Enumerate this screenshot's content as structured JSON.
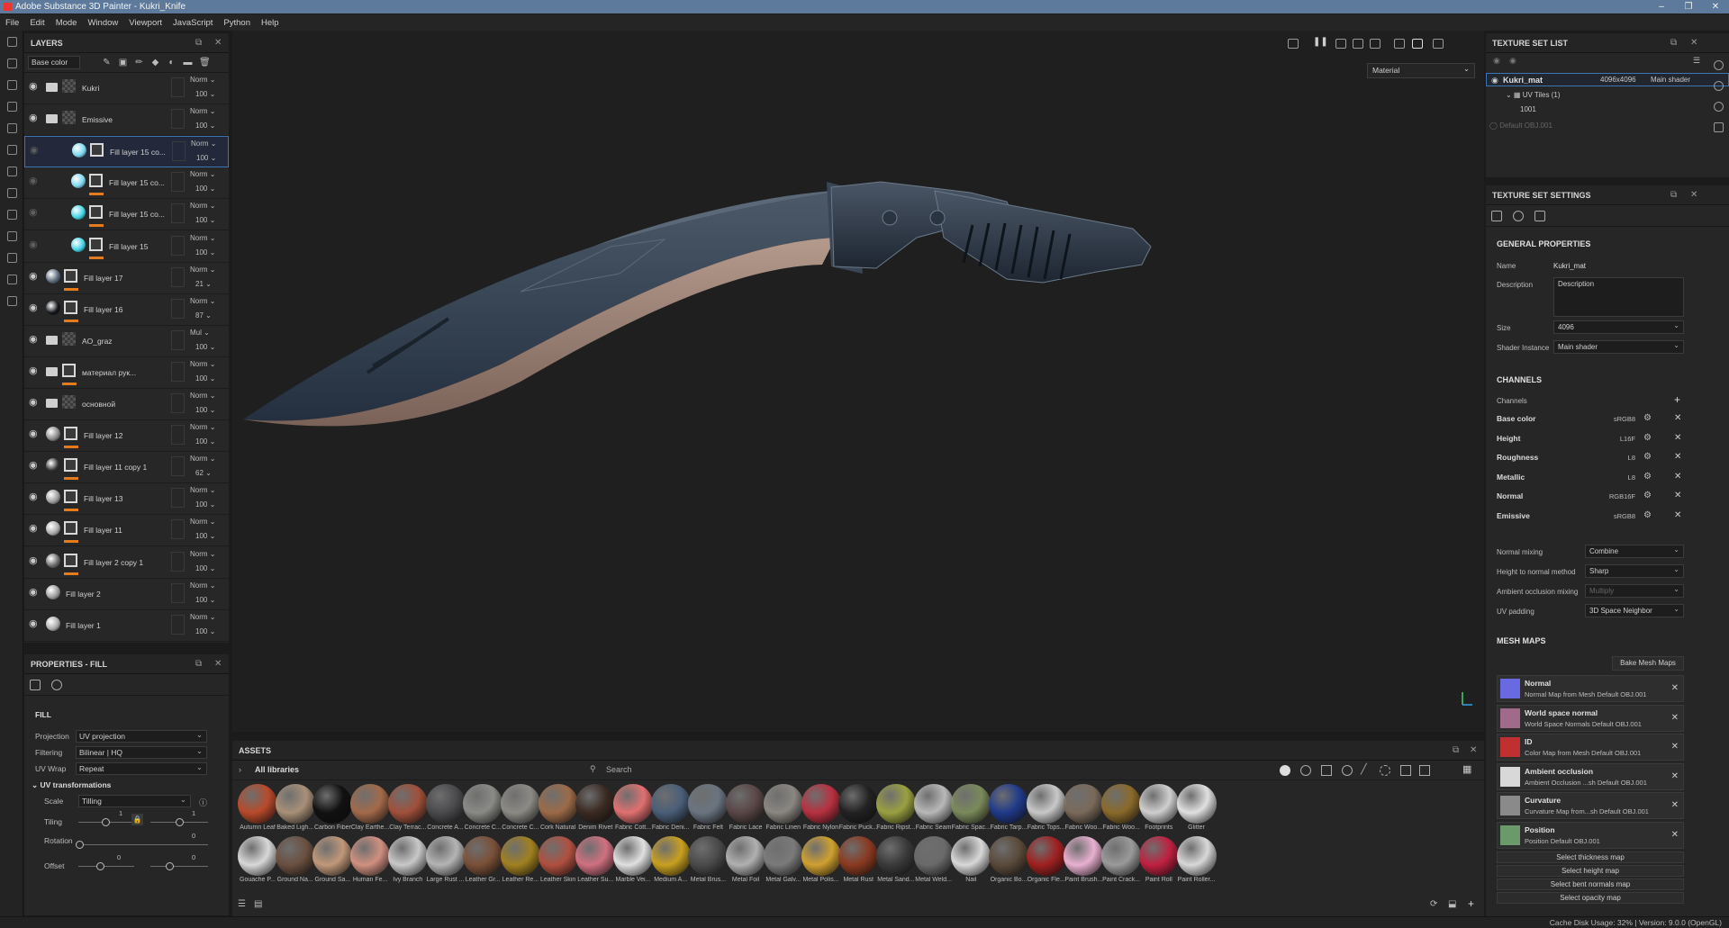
{
  "window": {
    "title": "Adobe Substance 3D Painter - Kukri_Knife"
  },
  "menu": [
    "File",
    "Edit",
    "Mode",
    "Window",
    "Viewport",
    "JavaScript",
    "Python",
    "Help"
  ],
  "layers": {
    "title": "LAYERS",
    "channel": "Base color",
    "items": [
      {
        "name": "Kukri",
        "blend": "Norm",
        "opacity": "100"
      },
      {
        "name": "Emissive",
        "blend": "Norm",
        "opacity": "100"
      },
      {
        "name": "Fill layer 15 co...",
        "blend": "Norm",
        "opacity": "100"
      },
      {
        "name": "Fill layer 15 co...",
        "blend": "Norm",
        "opacity": "100"
      },
      {
        "name": "Fill layer 15 co...",
        "blend": "Norm",
        "opacity": "100"
      },
      {
        "name": "Fill layer 15",
        "blend": "Norm",
        "opacity": "100"
      },
      {
        "name": "Fill layer 17",
        "blend": "Norm",
        "opacity": "21"
      },
      {
        "name": "Fill layer 16",
        "blend": "Norm",
        "opacity": "87"
      },
      {
        "name": "AO_graz",
        "blend": "Mul",
        "opacity": "100"
      },
      {
        "name": "материал рук...",
        "blend": "Norm",
        "opacity": "100"
      },
      {
        "name": "основной",
        "blend": "Norm",
        "opacity": "100"
      },
      {
        "name": "Fill layer 12",
        "blend": "Norm",
        "opacity": "100"
      },
      {
        "name": "Fill layer 11 copy 1",
        "blend": "Norm",
        "opacity": "62"
      },
      {
        "name": "Fill layer 13",
        "blend": "Norm",
        "opacity": "100"
      },
      {
        "name": "Fill layer 11",
        "blend": "Norm",
        "opacity": "100"
      },
      {
        "name": "Fill layer 2 copy 1",
        "blend": "Norm",
        "opacity": "100"
      },
      {
        "name": "Fill layer 2",
        "blend": "Norm",
        "opacity": "100"
      },
      {
        "name": "Fill layer 1",
        "blend": "Norm",
        "opacity": "100"
      }
    ]
  },
  "properties": {
    "title": "PROPERTIES - FILL",
    "section": "FILL",
    "projection_label": "Projection",
    "projection": "UV projection",
    "filtering_label": "Filtering",
    "filtering": "Bilinear | HQ",
    "uvwrap_label": "UV Wrap",
    "uvwrap": "Repeat",
    "uvtrans_label": "UV transformations",
    "scale_label": "Scale",
    "scale": "Tilling",
    "tiling_label": "Tiling",
    "tiling_value": "1",
    "tiling_value2": "1",
    "rotation_label": "Rotation",
    "rotation_value": "0",
    "offset_label": "Offset",
    "offset_value": "0",
    "offset_value2": "0"
  },
  "viewport": {
    "material_mode": "Material"
  },
  "assets": {
    "title": "ASSETS",
    "library": "All libraries",
    "search_placeholder": "Search",
    "row1": [
      {
        "n": "Autumn Leaf",
        "c": "#b84a2a"
      },
      {
        "n": "Baked Ligh...",
        "c": "#a89078"
      },
      {
        "n": "Carbon Fiber",
        "c": "#111111"
      },
      {
        "n": "Clay Earthe...",
        "c": "#a36a4a"
      },
      {
        "n": "Clay Terrac...",
        "c": "#a0503a"
      },
      {
        "n": "Concrete A...",
        "c": "#4a4a4e"
      },
      {
        "n": "Concrete C...",
        "c": "#8a8a86"
      },
      {
        "n": "Concrete C...",
        "c": "#8c8a84"
      },
      {
        "n": "Cork Natural",
        "c": "#9c6b48"
      },
      {
        "n": "Denim Rivet",
        "c": "#3a2a22"
      },
      {
        "n": "Fabric Cott...",
        "c": "#e07070"
      },
      {
        "n": "Fabric Deni...",
        "c": "#4a5e78"
      },
      {
        "n": "Fabric Felt",
        "c": "#6a7480"
      },
      {
        "n": "Fabric Lace",
        "c": "#5a4646"
      },
      {
        "n": "Fabric Linen",
        "c": "#8a8680"
      },
      {
        "n": "Fabric Nylon",
        "c": "#b83040"
      },
      {
        "n": "Fabric Puck...",
        "c": "#222222"
      },
      {
        "n": "Fabric Ripst...",
        "c": "#9aa040"
      },
      {
        "n": "Fabric Seam",
        "c": "#b8b8b8"
      },
      {
        "n": "Fabric Spac...",
        "c": "#7a8a5a"
      },
      {
        "n": "Fabric Tarp...",
        "c": "#203a8a"
      },
      {
        "n": "Fabric Tops...",
        "c": "#c8c8c8"
      },
      {
        "n": "Fabric Woo...",
        "c": "#7a6a5a"
      },
      {
        "n": "Fabric Woo...",
        "c": "#8a6a2a"
      },
      {
        "n": "Footprints",
        "c": "#cfcfcf"
      },
      {
        "n": "Glitter",
        "c": "#e0e0e0"
      }
    ],
    "row2": [
      {
        "n": "Gouache P...",
        "c": "#d8d8d8"
      },
      {
        "n": "Ground Na...",
        "c": "#6a5040"
      },
      {
        "n": "Ground Sa...",
        "c": "#c09878"
      },
      {
        "n": "Human Fe...",
        "c": "#d09080"
      },
      {
        "n": "Ivy Branch",
        "c": "#c8c8c8"
      },
      {
        "n": "Large Rust ...",
        "c": "#b4b4b4"
      },
      {
        "n": "Leather Gr...",
        "c": "#7a5038"
      },
      {
        "n": "Leather Re...",
        "c": "#a08020"
      },
      {
        "n": "Leather Skin",
        "c": "#b05040"
      },
      {
        "n": "Leather Su...",
        "c": "#d07080"
      },
      {
        "n": "Marble Vei...",
        "c": "#e0e0e0"
      },
      {
        "n": "Medium A...",
        "c": "#c8a020"
      },
      {
        "n": "Metal Brus...",
        "c": "#4a4a4a"
      },
      {
        "n": "Metal Foil",
        "c": "#b0b0b0"
      },
      {
        "n": "Metal Galv...",
        "c": "#7a7a7a"
      },
      {
        "n": "Metal Polis...",
        "c": "#d0a030"
      },
      {
        "n": "Metal Rust",
        "c": "#8a3a20"
      },
      {
        "n": "Metal Sand...",
        "c": "#3a3a3a"
      },
      {
        "n": "Metal Weld...",
        "c": "#6a6a6a"
      },
      {
        "n": "Nail",
        "c": "#d8d8d8"
      },
      {
        "n": "Organic Bo...",
        "c": "#5a4a3a"
      },
      {
        "n": "Organic Fle...",
        "c": "#a02020"
      },
      {
        "n": "Paint Brush...",
        "c": "#e8b0d0"
      },
      {
        "n": "Paint Crack...",
        "c": "#9a9a9a"
      },
      {
        "n": "Paint Roll",
        "c": "#c02040"
      },
      {
        "n": "Paint Roller...",
        "c": "#d8d8d8"
      }
    ]
  },
  "texture_set_list": {
    "title": "TEXTURE SET LIST",
    "name": "Kukri_mat",
    "size": "4096x4096",
    "shader": "Main shader",
    "uvtiles": "UV Tiles (1)",
    "tile": "1001",
    "default": "Default OBJ.001"
  },
  "texture_set_settings": {
    "title": "TEXTURE SET SETTINGS",
    "general": "GENERAL PROPERTIES",
    "name_label": "Name",
    "name": "Kukri_mat",
    "desc_label": "Description",
    "desc": "Description",
    "size_label": "Size",
    "size": "4096",
    "shader_label": "Shader Instance",
    "shader": "Main shader",
    "channels_title": "CHANNELS",
    "channels_label": "Channels",
    "channels": [
      {
        "name": "Base color",
        "fmt": "sRGB8"
      },
      {
        "name": "Height",
        "fmt": "L16F"
      },
      {
        "name": "Roughness",
        "fmt": "L8"
      },
      {
        "name": "Metallic",
        "fmt": "L8"
      },
      {
        "name": "Normal",
        "fmt": "RGB16F"
      },
      {
        "name": "Emissive",
        "fmt": "sRGB8"
      }
    ],
    "normal_mixing_label": "Normal mixing",
    "normal_mixing": "Combine",
    "h2n_label": "Height to normal method",
    "h2n": "Sharp",
    "ao_label": "Ambient occlusion mixing",
    "ao": "Multiply",
    "uvpad_label": "UV padding",
    "uvpad": "3D Space Neighbor",
    "meshmaps_title": "MESH MAPS",
    "bake_button": "Bake Mesh Maps",
    "meshmaps": [
      {
        "t": "Normal",
        "s": "Normal Map from Mesh Default OBJ.001",
        "c": "#6a6ae0"
      },
      {
        "t": "World space normal",
        "s": "World Space Normals Default OBJ.001",
        "c": "#a06a8a"
      },
      {
        "t": "ID",
        "s": "Color Map from Mesh Default OBJ.001",
        "c": "#c03030"
      },
      {
        "t": "Ambient occlusion",
        "s": "Ambient Occlusion ...sh Default OBJ.001",
        "c": "#d8d8d8"
      },
      {
        "t": "Curvature",
        "s": "Curvature Map from...sh Default OBJ.001",
        "c": "#8a8a8a"
      },
      {
        "t": "Position",
        "s": "Position Default OBJ.001",
        "c": "#6a9a6a"
      }
    ],
    "select_buttons": [
      "Select thickness map",
      "Select height map",
      "Select bent normals map",
      "Select opacity map"
    ]
  },
  "status": "Cache Disk Usage:  32% | Version: 9.0.0 (OpenGL)"
}
